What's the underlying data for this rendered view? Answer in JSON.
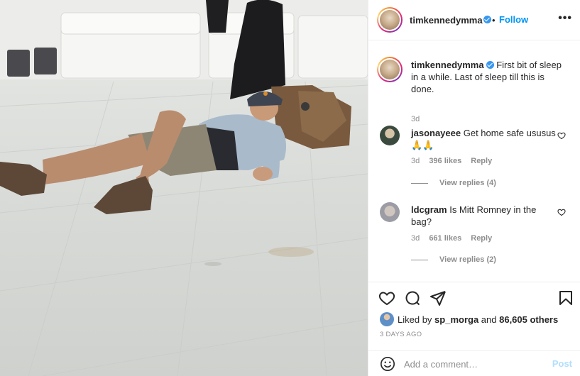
{
  "post": {
    "author": "timkennedymma",
    "follow_label": "Follow",
    "dot": "•",
    "more_label": "•••",
    "image_icon": "photo-of-man-sleeping-on-floor"
  },
  "caption": {
    "username": "timkennedymma",
    "text": "First bit of sleep in a while. Last of sleep till this is done.",
    "time": "3d"
  },
  "comments": [
    {
      "username": "jasonayeee",
      "text": "Get home safe ususus 🙏🙏",
      "time": "3d",
      "likes": "396 likes",
      "reply_label": "Reply",
      "view_replies": "View replies (4)"
    },
    {
      "username": "ldcgram",
      "text": "Is Mitt Romney in the bag?",
      "time": "3d",
      "likes": "661 likes",
      "reply_label": "Reply",
      "view_replies": "View replies (2)"
    }
  ],
  "likes": {
    "prefix": "Liked by ",
    "user": "sp_morga",
    "middle": " and ",
    "count": "86,605 others"
  },
  "time_ago": "3 DAYS AGO",
  "add_comment": {
    "placeholder": "Add a comment…",
    "post_label": "Post"
  },
  "colors": {
    "link_blue": "#0095f6",
    "post_disabled": "#b2dffc",
    "muted": "#8e8e8e",
    "text": "#262626"
  },
  "icons": [
    "heart-icon",
    "comment-icon",
    "share-icon",
    "bookmark-icon",
    "smile-icon",
    "verified-badge-icon",
    "more-options-icon"
  ]
}
